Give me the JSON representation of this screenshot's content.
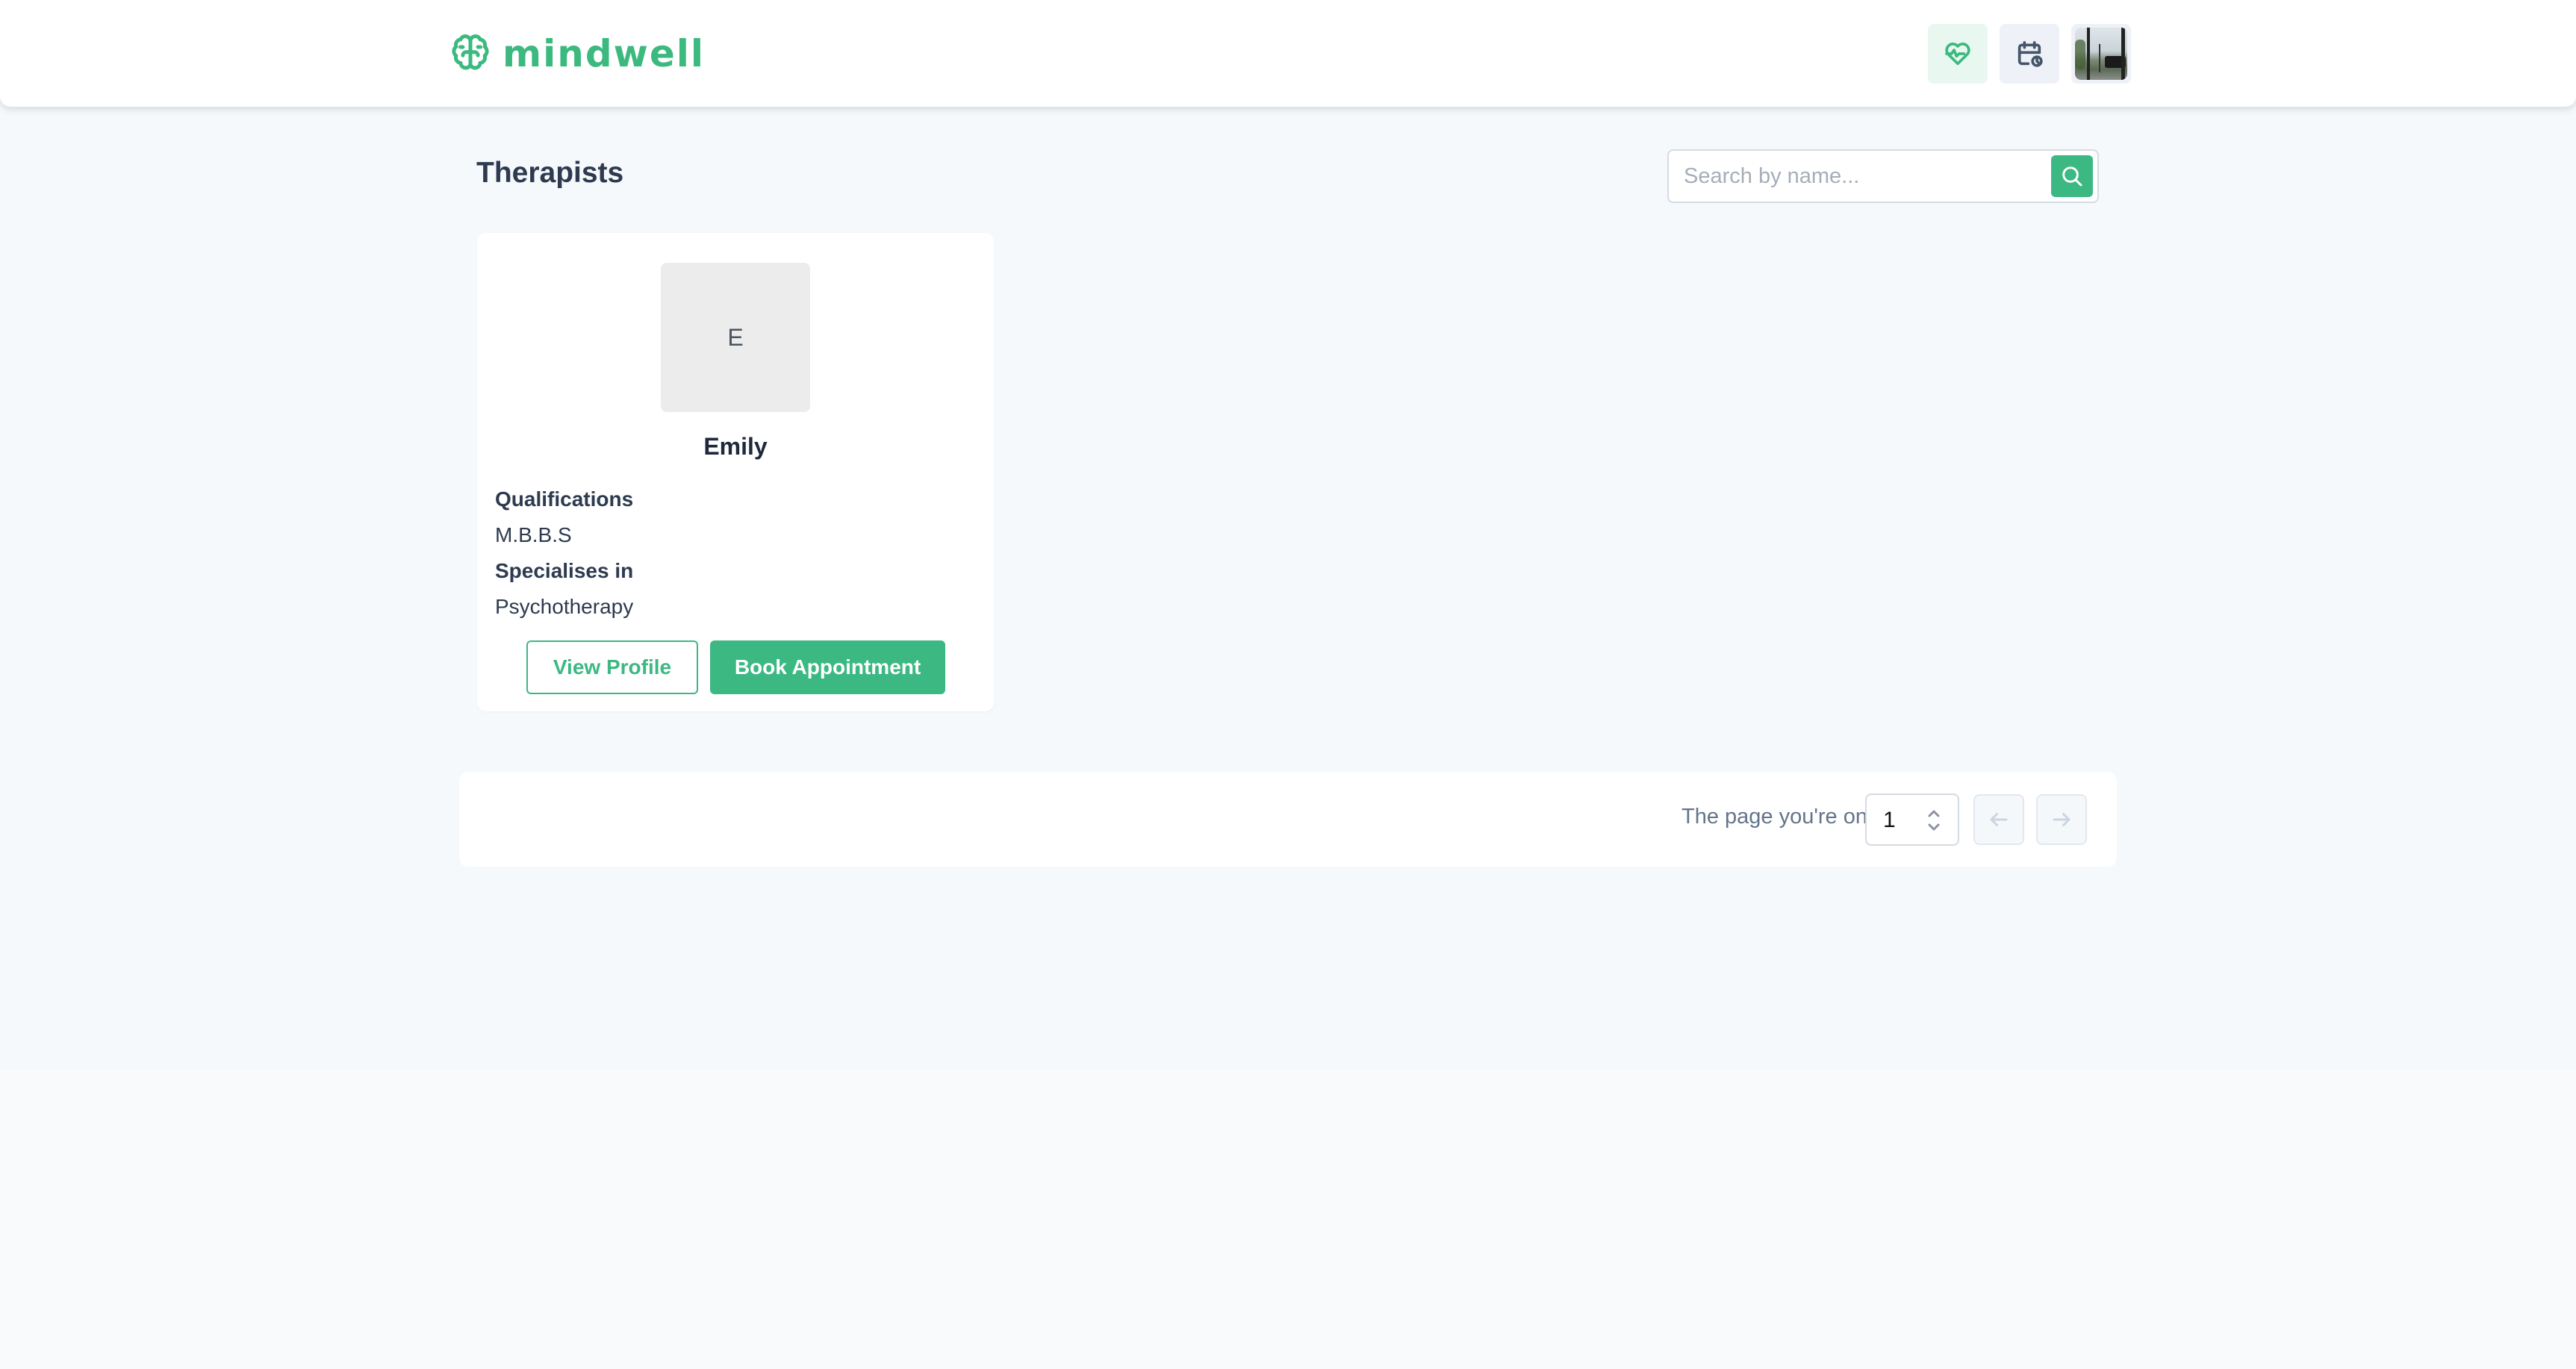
{
  "header": {
    "brand": "mindwell",
    "icons": {
      "logo": "brain-icon",
      "health": "heart-pulse-icon",
      "appointments": "calendar-clock-icon",
      "profile": "user-avatar-photo"
    }
  },
  "main": {
    "title": "Therapists",
    "search": {
      "placeholder": "Search by name...",
      "value": "",
      "button_icon": "search-icon"
    }
  },
  "therapists": [
    {
      "initial": "E",
      "name": "Emily",
      "qualifications_label": "Qualifications",
      "qualifications": "M.B.B.S",
      "specialises_label": "Specialises in",
      "specialisation": "Psychotherapy",
      "view_profile_label": "View Profile",
      "book_label": "Book Appointment"
    }
  ],
  "pagination": {
    "label": "The page you're on",
    "current_page": "1",
    "prev_icon": "arrow-left-icon",
    "next_icon": "arrow-right-icon",
    "prev_disabled": true,
    "next_disabled": true
  },
  "colors": {
    "brand": "#3cb883",
    "text_dark": "#2d3a4f",
    "muted": "#64748b",
    "background": "#f5f9fc"
  }
}
